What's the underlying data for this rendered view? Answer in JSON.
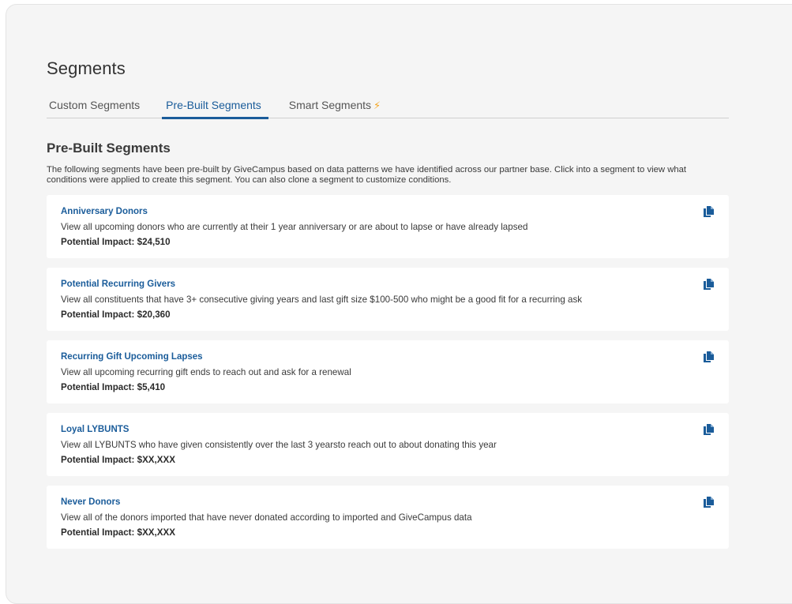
{
  "page": {
    "title": "Segments"
  },
  "tabs": [
    {
      "label": "Custom Segments",
      "active": false
    },
    {
      "label": "Pre-Built Segments",
      "active": true
    },
    {
      "label": "Smart Segments",
      "active": false,
      "icon": "lightning-bolt-icon"
    }
  ],
  "section": {
    "title": "Pre-Built Segments",
    "description": "The following segments have been pre-built by GiveCampus based on data patterns we have identified across our partner base. Click into a segment to view what conditions were applied to create this segment. You can also clone a segment to customize conditions."
  },
  "segments": [
    {
      "title": "Anniversary Donors",
      "description": "View all upcoming donors who are currently at their 1 year anniversary or are about to lapse or have already lapsed",
      "impact": "Potential Impact: $24,510"
    },
    {
      "title": "Potential Recurring Givers",
      "description": "View all constituents that have 3+ consecutive giving years and last gift size $100-500 who might be a good fit for a recurring ask",
      "impact": "Potential Impact: $20,360"
    },
    {
      "title": "Recurring Gift Upcoming Lapses",
      "description": "View all upcoming recurring gift ends to reach out and ask for a renewal",
      "impact": "Potential Impact: $5,410"
    },
    {
      "title": "Loyal LYBUNTS",
      "description": "View all LYBUNTS who have given consistently over the last 3 yearsto reach out to about donating this year",
      "impact": "Potential Impact: $XX,XXX"
    },
    {
      "title": "Never Donors",
      "description": "View all of the donors imported that have never donated according to imported and GiveCampus data",
      "impact": "Potential Impact: $XX,XXX"
    }
  ],
  "colors": {
    "accent": "#1a5c9a",
    "bolt": "#f5a623",
    "panel_bg": "#f5f5f5",
    "card_bg": "#ffffff"
  },
  "icons": {
    "copy": "copy-icon",
    "bolt": "lightning-bolt-icon"
  }
}
